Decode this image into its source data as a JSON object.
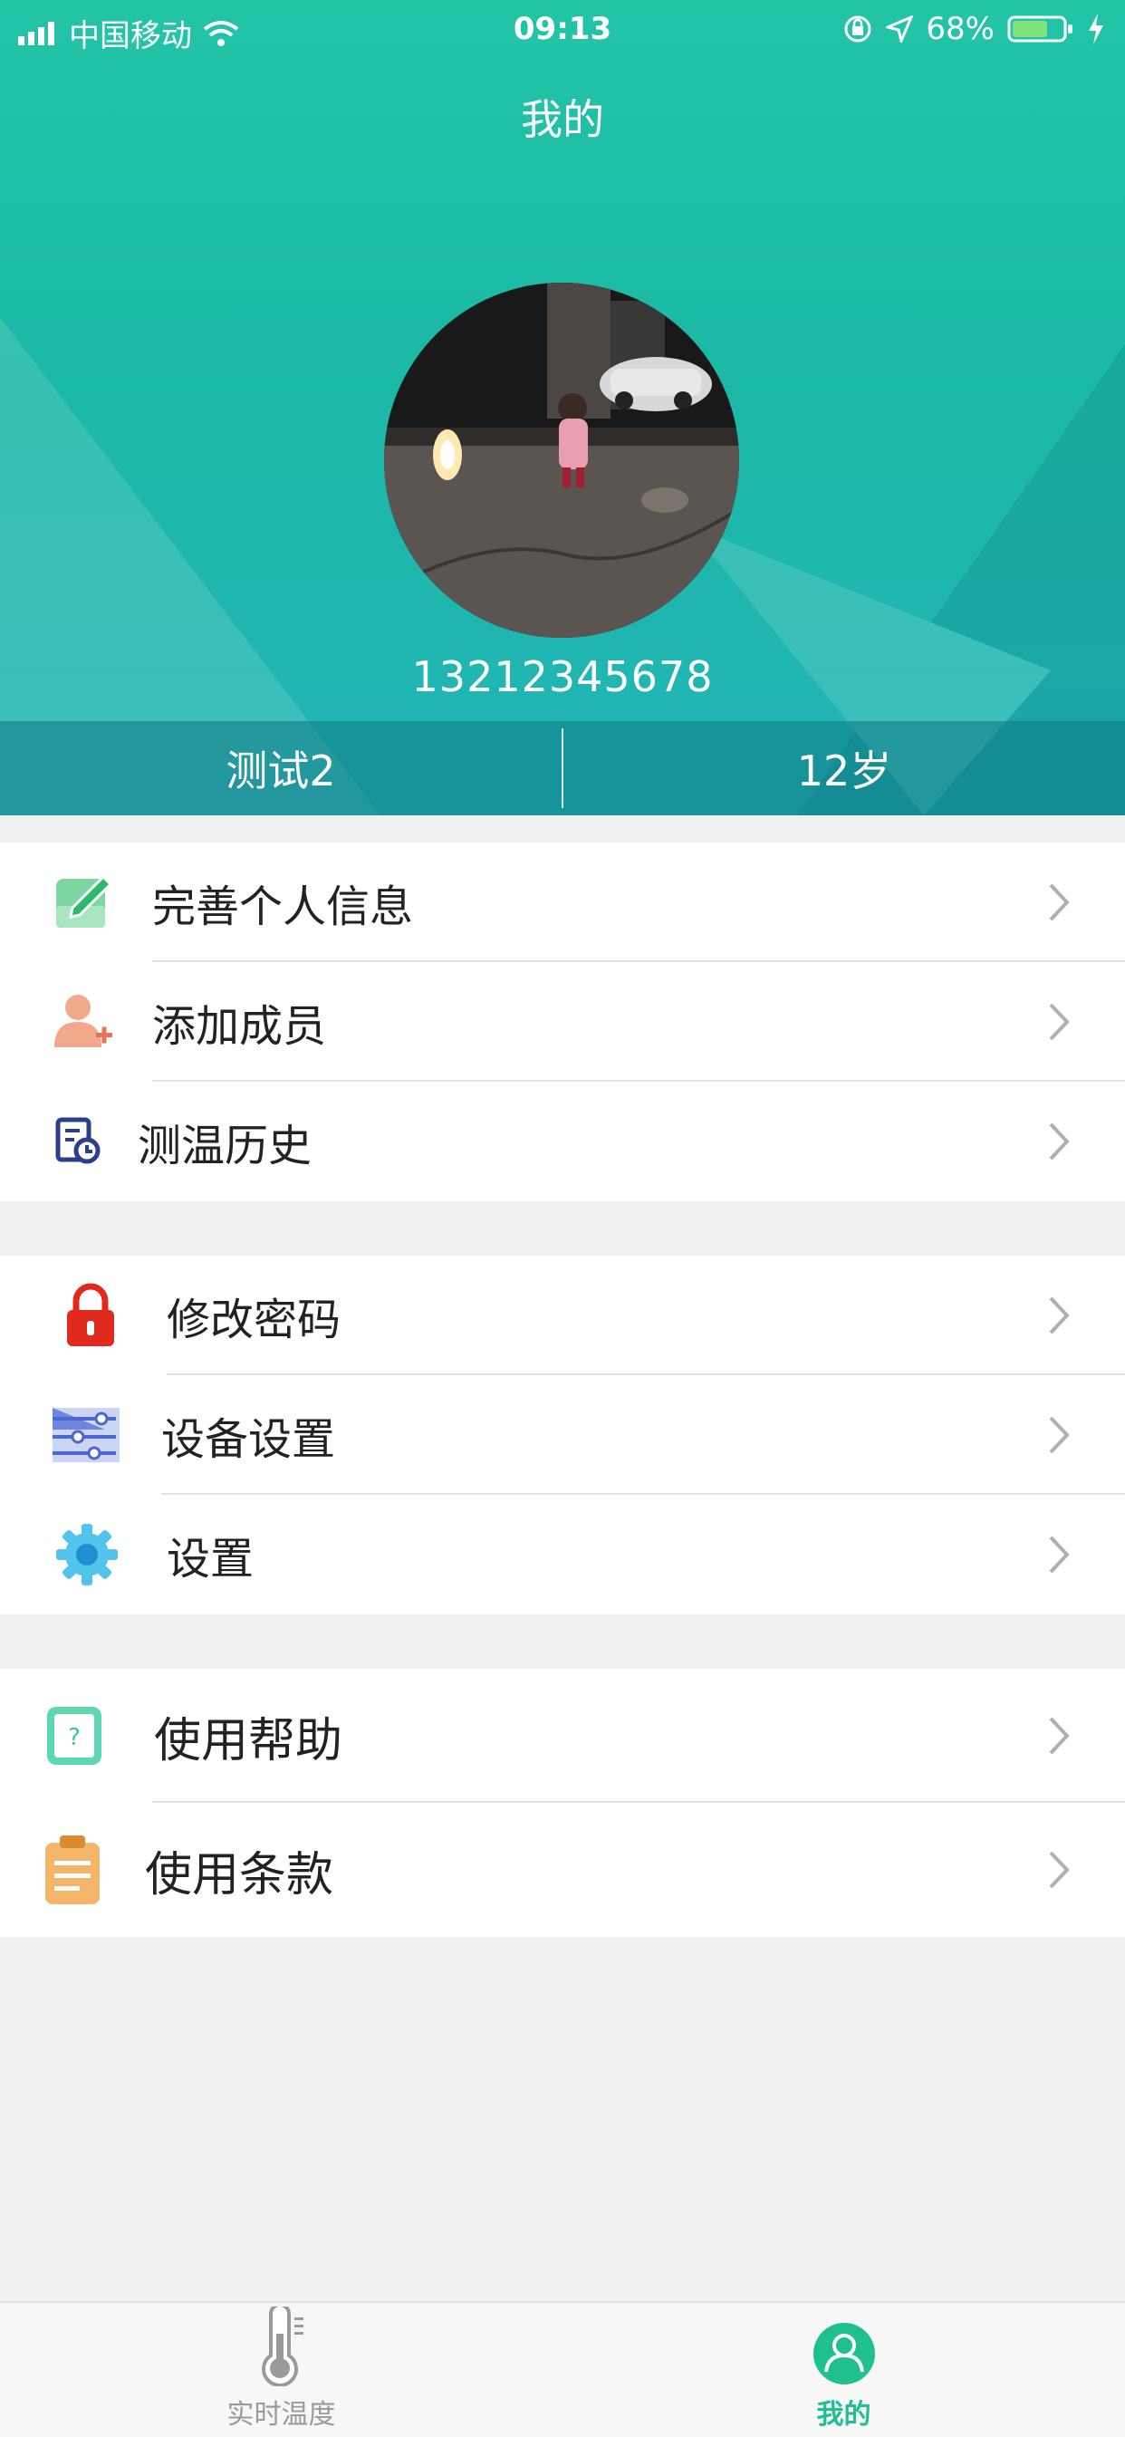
{
  "status_bar": {
    "carrier": "中国移动",
    "time": "09:13",
    "battery": "68%"
  },
  "header": {
    "title": "我的",
    "phone": "13212345678",
    "name": "测试2",
    "age": "12岁"
  },
  "groups": [
    {
      "items": [
        {
          "label": "完善个人信息",
          "icon": "edit-profile-icon"
        },
        {
          "label": "添加成员",
          "icon": "add-member-icon"
        },
        {
          "label": "测温历史",
          "icon": "history-icon"
        }
      ]
    },
    {
      "items": [
        {
          "label": "修改密码",
          "icon": "lock-icon"
        },
        {
          "label": "设备设置",
          "icon": "device-settings-icon"
        },
        {
          "label": "设置",
          "icon": "gear-icon"
        }
      ]
    },
    {
      "items": [
        {
          "label": "使用帮助",
          "icon": "help-icon"
        },
        {
          "label": "使用条款",
          "icon": "clipboard-icon"
        }
      ]
    }
  ],
  "tabbar": {
    "tabs": [
      {
        "label": "实时温度",
        "icon": "thermometer-icon",
        "active": false
      },
      {
        "label": "我的",
        "icon": "profile-icon",
        "active": true
      }
    ]
  },
  "colors": {
    "accent": "#1fbfa5",
    "tab_active": "#1fbf8f",
    "tab_inactive": "#9a9a9a"
  }
}
